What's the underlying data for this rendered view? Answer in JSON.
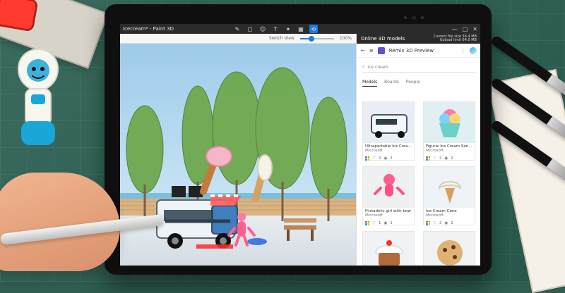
{
  "app": {
    "window_title": "Icecream* - Paint 3D",
    "panel_title": "Online 3D models",
    "status_line_1": "Current file size 56.4 MB",
    "status_line_2": "Upload limit 64.0 MB",
    "view_label": "Switch View",
    "zoom_label": "100%",
    "zoom_value": 0.34
  },
  "remix": {
    "brand": "Remix 3D Preview",
    "search_placeholder": "ice cream"
  },
  "tabs": [
    {
      "label": "Models",
      "active": true
    },
    {
      "label": "Boards",
      "active": false
    },
    {
      "label": "People",
      "active": false
    }
  ],
  "models": [
    {
      "title": "Ultraportable Ice Crea...",
      "author": "Microsoft",
      "likes": "2",
      "views": "2"
    },
    {
      "title": "Figurie Ice Cream San...",
      "author": "Microsoft",
      "likes": "2",
      "views": "2"
    },
    {
      "title": "Pinkadelic girl with bow",
      "author": "Microsoft",
      "likes": "1",
      "views": "1"
    },
    {
      "title": "Ice Cream Cone",
      "author": "Microsoft",
      "likes": "2",
      "views": "2"
    }
  ],
  "colors": {
    "accent": "#1f7ae0",
    "dark_bar": "#2b2b2b"
  },
  "icons": {
    "tools": [
      "brush-icon",
      "shapes-icon",
      "stickers-icon",
      "text-icon",
      "effects-icon",
      "canvas-icon",
      "remix-3d-icon"
    ],
    "window": [
      "minimize-icon",
      "maximize-icon",
      "close-icon"
    ],
    "search": "search-icon"
  }
}
